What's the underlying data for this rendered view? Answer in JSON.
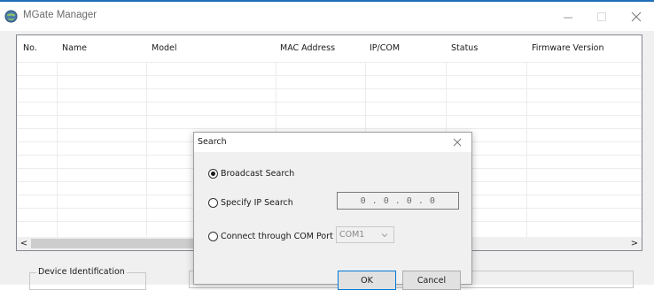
{
  "window": {
    "title": "MGate Manager",
    "icons": {
      "app": "globe-icon",
      "minimize": "minimize-icon",
      "maximize": "maximize-icon",
      "close": "close-icon"
    }
  },
  "device_table": {
    "columns": [
      "No.",
      "Name",
      "Model",
      "MAC Address",
      "IP/COM",
      "Status",
      "Firmware Version"
    ],
    "rows": []
  },
  "scrollbar": {
    "left_arrow": "<",
    "right_arrow": ">"
  },
  "bottom": {
    "device_identification_label": "Device Identification"
  },
  "search_dialog": {
    "title": "Search",
    "options": {
      "broadcast": {
        "label": "Broadcast Search",
        "selected": true
      },
      "specify_ip": {
        "label": "Specify IP Search",
        "selected": false,
        "ip_value": "0 . 0 . 0 . 0"
      },
      "com_port": {
        "label": "Connect through COM Port",
        "selected": false,
        "port_value": "COM1"
      }
    },
    "ok_label": "OK",
    "cancel_label": "Cancel"
  },
  "colors": {
    "accent_border": "#1f6fb8",
    "window_bg": "#f0f0f0",
    "focus_border": "#0078d7"
  }
}
